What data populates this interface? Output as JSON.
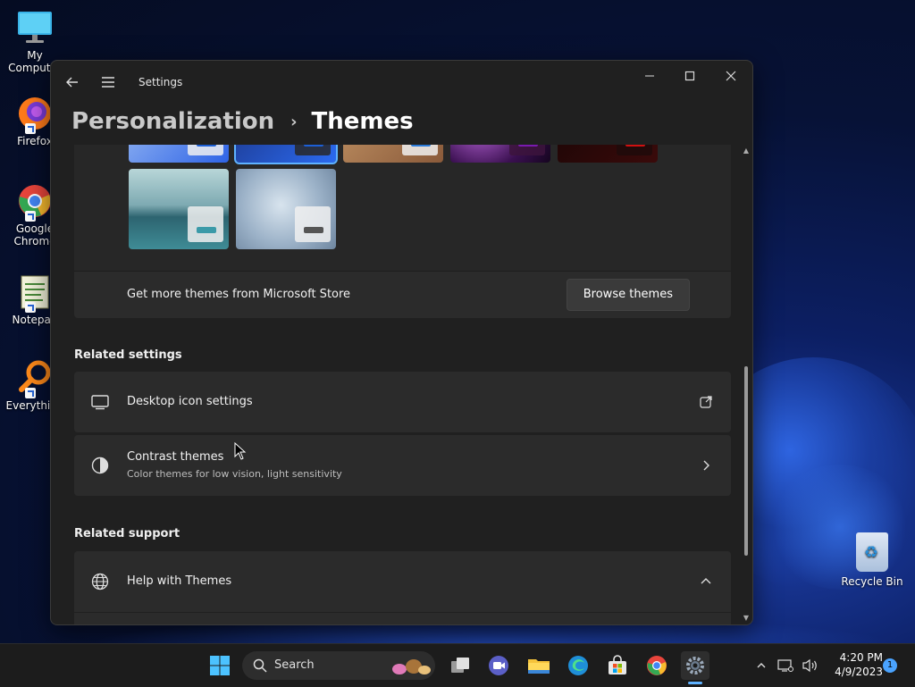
{
  "desktop": {
    "icons": [
      {
        "label": "My Computer"
      },
      {
        "label": "Firefox"
      },
      {
        "label": "Google Chrome"
      },
      {
        "label": "Notepad"
      },
      {
        "label": "Everything"
      }
    ],
    "recycle_bin": "Recycle Bin"
  },
  "window": {
    "app_title": "Settings",
    "breadcrumb": {
      "parent": "Personalization",
      "current": "Themes"
    },
    "store_row": {
      "text": "Get more themes from Microsoft Store",
      "button": "Browse themes"
    },
    "related_settings": {
      "heading": "Related settings",
      "items": [
        {
          "title": "Desktop icon settings"
        },
        {
          "title": "Contrast themes",
          "subtitle": "Color themes for low vision, light sensitivity"
        }
      ]
    },
    "related_support": {
      "heading": "Related support",
      "items": [
        {
          "title": "Help with Themes"
        }
      ]
    }
  },
  "taskbar": {
    "search_placeholder": "Search",
    "time": "4:20 PM",
    "date": "4/9/2023",
    "notification_count": "1"
  },
  "colors": {
    "accent": "#5fb2ff",
    "window_bg": "#202020",
    "card_bg": "#2b2b2b"
  }
}
